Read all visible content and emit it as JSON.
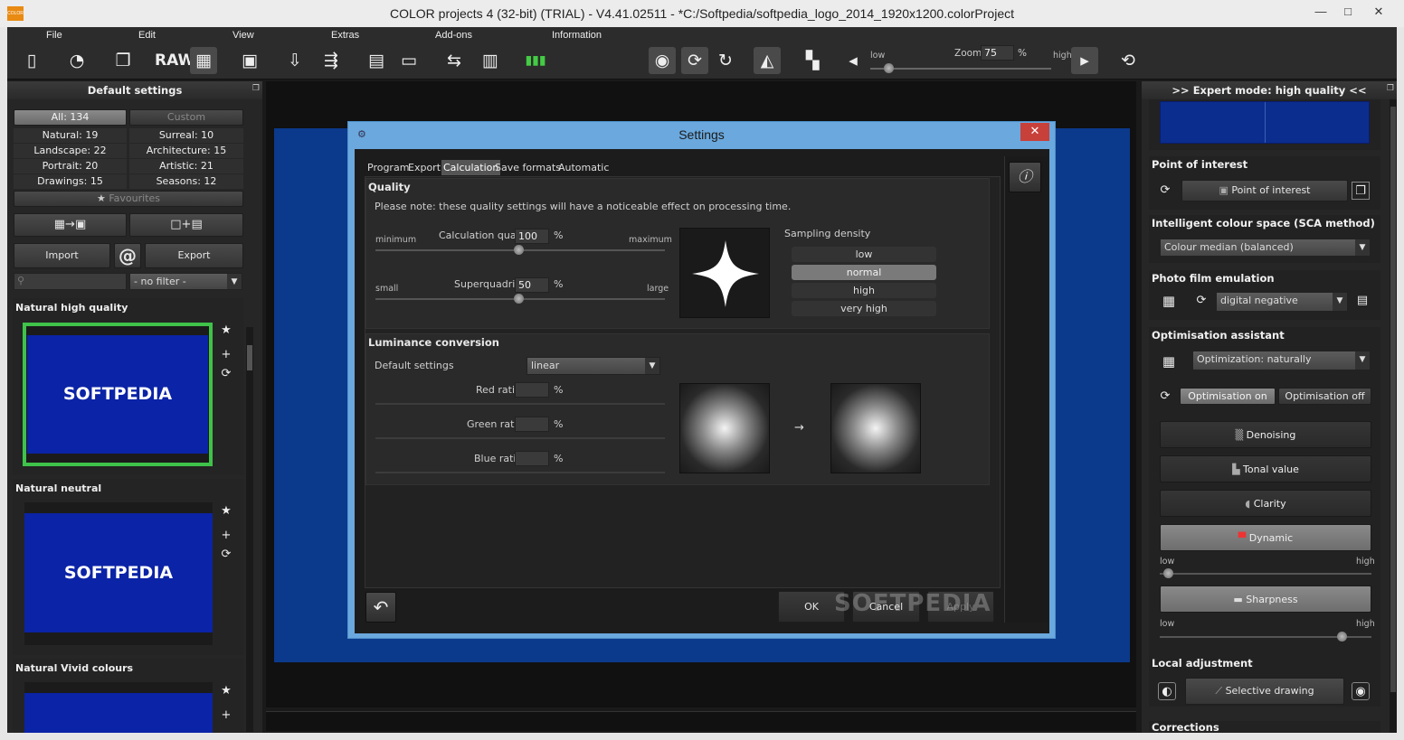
{
  "window": {
    "title": "COLOR projects 4 (32-bit) (TRIAL) - V4.41.02511 - *C:/Softpedia/softpedia_logo_2014_1920x1200.colorProject",
    "app_icon": "COLOR",
    "minimize": "—",
    "maximize": "□",
    "close": "✕"
  },
  "menu": [
    "File",
    "Edit",
    "View",
    "Extras",
    "Add-ons",
    "Information"
  ],
  "toolbar": {
    "raw_label": "RAW",
    "zoom_label": "Zoom",
    "zoom_value": "75",
    "zoom_unit": "%",
    "low": "low",
    "high": "high"
  },
  "left_panel": {
    "title": "Default settings",
    "filters": {
      "all": "All: 134",
      "custom": "Custom",
      "natural": "Natural: 19",
      "surreal": "Surreal: 10",
      "landscape": "Landscape: 22",
      "architecture": "Architecture: 15",
      "portrait": "Portrait: 20",
      "artistic": "Artistic: 21",
      "drawings": "Drawings: 15",
      "seasons": "Seasons: 12",
      "favourites": "Favourites"
    },
    "import": "Import",
    "at": "@",
    "export": "Export",
    "filter_select": "- no filter -",
    "presets": [
      {
        "name": "Natural high quality",
        "logo": "SOFTPEDIA"
      },
      {
        "name": "Natural neutral",
        "logo": "SOFTPEDIA"
      },
      {
        "name": "Natural Vivid colours",
        "logo": ""
      }
    ]
  },
  "right_panel": {
    "title": ">> Expert mode: high quality <<",
    "poi": {
      "head": "Point of interest",
      "button": "Point of interest"
    },
    "sca": {
      "head": "Intelligent colour space (SCA method)",
      "value": "Colour median (balanced)"
    },
    "film": {
      "head": "Photo film emulation",
      "value": "digital negative"
    },
    "opt": {
      "head": "Optimisation assistant",
      "value": "Optimization: naturally",
      "on": "Optimisation on",
      "off": "Optimisation off"
    },
    "tools": {
      "denoising": "Denoising",
      "tonal": "Tonal value",
      "clarity": "Clarity",
      "dynamic": "Dynamic",
      "sharpness": "Sharpness"
    },
    "low": "low",
    "high": "high",
    "dynamic_level": 0.02,
    "sharpness_level": 0.88,
    "local": {
      "head": "Local adjustment",
      "button": "Selective drawing"
    },
    "corrections": "Corrections"
  },
  "dialog": {
    "title": "Settings",
    "tabs": [
      "Program",
      "Export",
      "Calculation",
      "Save formats",
      "Automatic"
    ],
    "active_tab": "Calculation",
    "quality": {
      "head": "Quality",
      "note": "Please note: these quality settings will have a noticeable effect on processing time.",
      "calc_min": "minimum",
      "calc_label": "Calculation quality",
      "calc_value": "100",
      "calc_max": "maximum",
      "sq_min": "small",
      "sq_label": "Superquadrics",
      "sq_value": "50",
      "sq_max": "large",
      "pct": "%",
      "sampling_head": "Sampling density",
      "sampling": [
        "low",
        "normal",
        "high",
        "very high"
      ],
      "sampling_selected": "normal"
    },
    "luminance": {
      "head": "Luminance conversion",
      "default_label": "Default settings",
      "default_value": "linear",
      "red": "Red ratio",
      "green": "Green ratio",
      "blue": "Blue ratio",
      "pct": "%",
      "arrow": "→"
    },
    "ok": "OK",
    "cancel": "Cancel",
    "apply": "Apply",
    "watermark": "SOFTPEDIA"
  },
  "colors": {
    "canvas_blue": "#0b3a8c",
    "preview_blue": "#0b23a6",
    "selected_frame": "#3fc24a",
    "dialog_frame": "#6aa8dd",
    "close_red": "#c8403a"
  }
}
